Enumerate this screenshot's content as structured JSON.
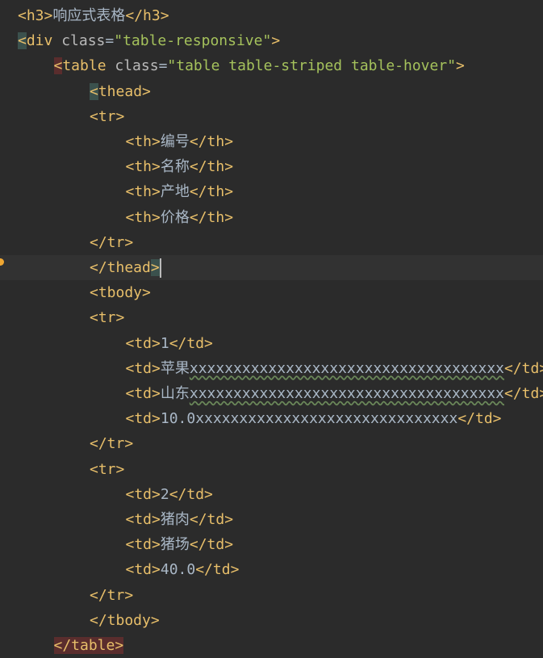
{
  "lines": [
    {
      "indent": 0,
      "tokens": [
        {
          "t": "tag",
          "v": "<h3>"
        },
        {
          "t": "text",
          "v": "响应式表格"
        },
        {
          "t": "tag",
          "v": "</h3>"
        }
      ]
    },
    {
      "indent": 0,
      "tokens": [
        {
          "t": "tag bracket",
          "v": "<"
        },
        {
          "t": "tag",
          "v": "div"
        },
        {
          "t": "attr",
          "v": " class"
        },
        {
          "t": "eq",
          "v": "="
        },
        {
          "t": "str",
          "v": "\"table-responsive\""
        },
        {
          "t": "tag",
          "v": ">"
        }
      ]
    },
    {
      "indent": 1,
      "tokens": [
        {
          "t": "tag bracket-red",
          "v": "<"
        },
        {
          "t": "tag",
          "v": "table"
        },
        {
          "t": "attr",
          "v": " class"
        },
        {
          "t": "eq",
          "v": "="
        },
        {
          "t": "str",
          "v": "\"table table-striped table-hover\""
        },
        {
          "t": "tag",
          "v": ">"
        }
      ]
    },
    {
      "indent": 2,
      "tokens": [
        {
          "t": "tag bracket",
          "v": "<"
        },
        {
          "t": "tag",
          "v": "thead>"
        }
      ]
    },
    {
      "indent": 2,
      "tokens": [
        {
          "t": "tag",
          "v": "<tr>"
        }
      ]
    },
    {
      "indent": 3,
      "tokens": [
        {
          "t": "tag",
          "v": "<th>"
        },
        {
          "t": "text",
          "v": "编号"
        },
        {
          "t": "tag",
          "v": "</th>"
        }
      ]
    },
    {
      "indent": 3,
      "tokens": [
        {
          "t": "tag",
          "v": "<th>"
        },
        {
          "t": "text",
          "v": "名称"
        },
        {
          "t": "tag",
          "v": "</th>"
        }
      ]
    },
    {
      "indent": 3,
      "tokens": [
        {
          "t": "tag",
          "v": "<th>"
        },
        {
          "t": "text",
          "v": "产地"
        },
        {
          "t": "tag",
          "v": "</th>"
        }
      ]
    },
    {
      "indent": 3,
      "tokens": [
        {
          "t": "tag",
          "v": "<th>"
        },
        {
          "t": "text",
          "v": "价格"
        },
        {
          "t": "tag",
          "v": "</th>"
        }
      ]
    },
    {
      "indent": 2,
      "tokens": [
        {
          "t": "tag",
          "v": "</tr>"
        }
      ]
    },
    {
      "indent": 2,
      "current": true,
      "tokens": [
        {
          "t": "tag",
          "v": "</thead"
        },
        {
          "t": "tag bracket",
          "v": ">"
        }
      ]
    },
    {
      "indent": 2,
      "tokens": [
        {
          "t": "tag",
          "v": "<tbody>"
        }
      ]
    },
    {
      "indent": 2,
      "tokens": [
        {
          "t": "tag",
          "v": "<tr>"
        }
      ]
    },
    {
      "indent": 3,
      "tokens": [
        {
          "t": "tag",
          "v": "<td>"
        },
        {
          "t": "text",
          "v": "1"
        },
        {
          "t": "tag",
          "v": "</td>"
        }
      ]
    },
    {
      "indent": 3,
      "tokens": [
        {
          "t": "tag",
          "v": "<td>"
        },
        {
          "t": "text",
          "v": "苹果"
        },
        {
          "t": "text squiggle",
          "v": "xxxxxxxxxxxxxxxxxxxxxxxxxxxxxxxxxxxx"
        },
        {
          "t": "tag",
          "v": "</td>"
        }
      ]
    },
    {
      "indent": 3,
      "tokens": [
        {
          "t": "tag",
          "v": "<td>"
        },
        {
          "t": "text",
          "v": "山东"
        },
        {
          "t": "text squiggle",
          "v": "xxxxxxxxxxxxxxxxxxxxxxxxxxxxxxxxxxxx"
        },
        {
          "t": "tag",
          "v": "</td>"
        }
      ]
    },
    {
      "indent": 3,
      "tokens": [
        {
          "t": "tag",
          "v": "<td>"
        },
        {
          "t": "text",
          "v": "10.0xxxxxxxxxxxxxxxxxxxxxxxxxxxxxx"
        },
        {
          "t": "tag",
          "v": "</td>"
        }
      ]
    },
    {
      "indent": 2,
      "tokens": [
        {
          "t": "tag",
          "v": "</tr>"
        }
      ]
    },
    {
      "indent": 2,
      "tokens": [
        {
          "t": "tag",
          "v": "<tr>"
        }
      ]
    },
    {
      "indent": 3,
      "tokens": [
        {
          "t": "tag",
          "v": "<td>"
        },
        {
          "t": "text",
          "v": "2"
        },
        {
          "t": "tag",
          "v": "</td>"
        }
      ]
    },
    {
      "indent": 3,
      "tokens": [
        {
          "t": "tag",
          "v": "<td>"
        },
        {
          "t": "text",
          "v": "猪肉"
        },
        {
          "t": "tag",
          "v": "</td>"
        }
      ]
    },
    {
      "indent": 3,
      "tokens": [
        {
          "t": "tag",
          "v": "<td>"
        },
        {
          "t": "text",
          "v": "猪场"
        },
        {
          "t": "tag",
          "v": "</td>"
        }
      ]
    },
    {
      "indent": 3,
      "tokens": [
        {
          "t": "tag",
          "v": "<td>"
        },
        {
          "t": "text",
          "v": "40.0"
        },
        {
          "t": "tag",
          "v": "</td>"
        }
      ]
    },
    {
      "indent": 2,
      "tokens": [
        {
          "t": "tag",
          "v": "</tr>"
        }
      ]
    },
    {
      "indent": 2,
      "tokens": [
        {
          "t": "tag",
          "v": "</tbody>"
        }
      ]
    },
    {
      "indent": 1,
      "tokens": [
        {
          "t": "tag bracket-red",
          "v": "</table>"
        }
      ]
    }
  ]
}
